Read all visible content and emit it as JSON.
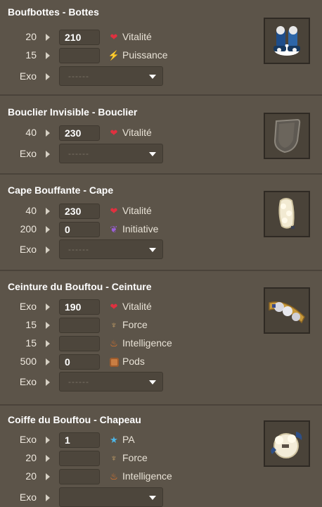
{
  "items": [
    {
      "title": "Boufbottes - Bottes",
      "image": "boots-icon",
      "rows": [
        {
          "level": "20",
          "value": "210",
          "icon": "heart-icon",
          "stat": "Vitalité"
        },
        {
          "level": "15",
          "value": "",
          "icon": "lightning-icon",
          "stat": "Puissance"
        }
      ],
      "exo": {
        "label": "Exo",
        "placeholder": "------"
      }
    },
    {
      "title": "Bouclier Invisible - Bouclier",
      "image": "shield-icon",
      "rows": [
        {
          "level": "40",
          "value": "230",
          "icon": "heart-icon",
          "stat": "Vitalité"
        }
      ],
      "exo": {
        "label": "Exo",
        "placeholder": "------"
      }
    },
    {
      "title": "Cape Bouffante - Cape",
      "image": "cape-icon",
      "rows": [
        {
          "level": "40",
          "value": "230",
          "icon": "heart-icon",
          "stat": "Vitalité"
        },
        {
          "level": "200",
          "value": "0",
          "icon": "wing-icon",
          "stat": "Initiative"
        }
      ],
      "exo": {
        "label": "Exo",
        "placeholder": "------"
      }
    },
    {
      "title": "Ceinture du Bouftou - Ceinture",
      "image": "belt-icon",
      "rows": [
        {
          "level": "Exo",
          "value": "190",
          "icon": "heart-icon",
          "stat": "Vitalité"
        },
        {
          "level": "15",
          "value": "",
          "icon": "force-icon",
          "stat": "Force"
        },
        {
          "level": "15",
          "value": "",
          "icon": "fire-icon",
          "stat": "Intelligence"
        },
        {
          "level": "500",
          "value": "0",
          "icon": "pods-icon",
          "stat": "Pods"
        }
      ],
      "exo": {
        "label": "Exo",
        "placeholder": "------"
      }
    },
    {
      "title": "Coiffe du Bouftou - Chapeau",
      "image": "hat-icon",
      "rows": [
        {
          "level": "Exo",
          "value": "1",
          "icon": "star-icon",
          "stat": "PA"
        },
        {
          "level": "20",
          "value": "",
          "icon": "force-icon",
          "stat": "Force"
        },
        {
          "level": "20",
          "value": "",
          "icon": "fire-icon",
          "stat": "Intelligence"
        }
      ],
      "exo": {
        "label": "Exo",
        "placeholder": ""
      }
    }
  ]
}
